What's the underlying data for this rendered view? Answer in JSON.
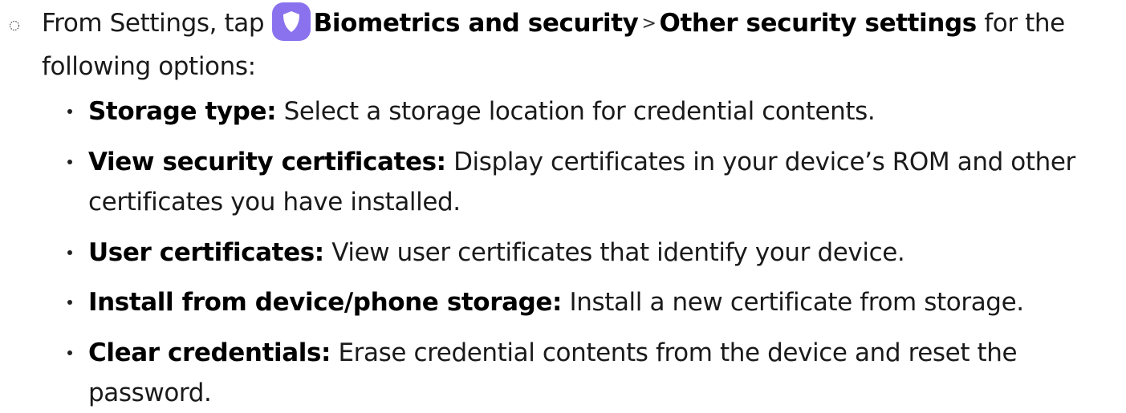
{
  "step": {
    "intro": "From Settings, tap ",
    "menu_item": "Biometrics and security",
    "separator": ">",
    "submenu_item": "Other security settings",
    "outro": " for the following options:",
    "icon": "shield-icon",
    "icon_color": "#8a72ee"
  },
  "options": [
    {
      "term": "Storage type",
      "colon": ":",
      "description": " Select a storage location for credential contents."
    },
    {
      "term": "View security certificates",
      "colon": ":",
      "description": " Display certificates in your device’s ROM and other certificates you have installed."
    },
    {
      "term": "User certificates",
      "colon": ":",
      "description": " View user certificates that identify your device."
    },
    {
      "term": "Install from device/phone storage",
      "colon": ":",
      "description": " Install a new certificate from storage."
    },
    {
      "term": "Clear credentials",
      "colon": ":",
      "description": " Erase credential contents from the device and reset the password."
    }
  ]
}
